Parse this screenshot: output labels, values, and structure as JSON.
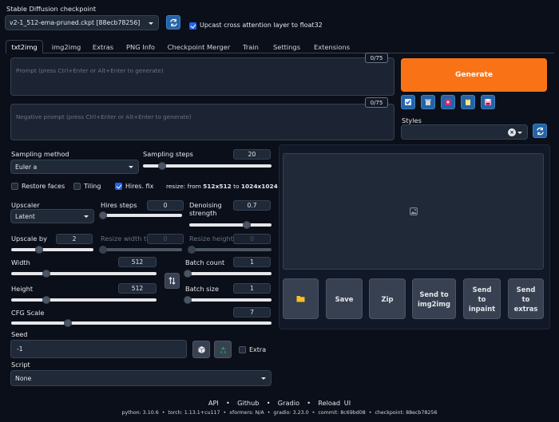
{
  "header": {
    "checkpoint_label": "Stable Diffusion checkpoint",
    "checkpoint_value": "v2-1_512-ema-pruned.ckpt [88ecb78256]",
    "upcast_label": "Upcast cross attention layer to float32"
  },
  "tabs": [
    {
      "label": "txt2img"
    },
    {
      "label": "img2img"
    },
    {
      "label": "Extras"
    },
    {
      "label": "PNG Info"
    },
    {
      "label": "Checkpoint Merger"
    },
    {
      "label": "Train"
    },
    {
      "label": "Settings"
    },
    {
      "label": "Extensions"
    }
  ],
  "prompt": {
    "placeholder": "Prompt (press Ctrl+Enter or Alt+Enter to generate)",
    "counter": "0/75"
  },
  "negative_prompt": {
    "placeholder": "Negative prompt (press Ctrl+Enter or Alt+Enter to generate)",
    "counter": "0/75"
  },
  "generate_label": "Generate",
  "styles_label": "Styles",
  "sampling": {
    "method_label": "Sampling method",
    "method_value": "Euler a",
    "steps_label": "Sampling steps",
    "steps_value": "20",
    "steps_level": 0.2
  },
  "options": {
    "restore_faces": "Restore faces",
    "tiling": "Tiling",
    "hires_fix": "Hires. fix",
    "resize_prefix": "resize: from ",
    "resize_from": "512x512",
    "resize_mid": " to ",
    "resize_to": "1024x1024"
  },
  "hires": {
    "upscaler_label": "Upscaler",
    "upscaler_value": "Latent",
    "hires_steps_label": "Hires steps",
    "hires_steps_value": "0",
    "denoising_label": "Denoising strength",
    "denoising_value": "0.7",
    "upscale_by_label": "Upscale by",
    "upscale_by_value": "2",
    "resize_width_label": "Resize width to",
    "resize_width_value": "0",
    "resize_height_label": "Resize height to",
    "resize_height_value": "0"
  },
  "size": {
    "width_label": "Width",
    "width_value": "512",
    "height_label": "Height",
    "height_value": "512",
    "batch_count_label": "Batch count",
    "batch_count_value": "1",
    "batch_size_label": "Batch size",
    "batch_size_value": "1"
  },
  "cfg": {
    "label": "CFG Scale",
    "value": "7"
  },
  "seed": {
    "label": "Seed",
    "value": "-1",
    "extra_label": "Extra"
  },
  "script": {
    "label": "Script",
    "value": "None"
  },
  "gallery_buttons": [
    "Save",
    "Zip",
    "Send to img2img",
    "Send to inpaint",
    "Send to extras"
  ],
  "footer": {
    "links": [
      "API",
      "Github",
      "Gradio",
      "Reload UI"
    ],
    "sep": "•",
    "info": "python: 3.10.6  •  torch: 1.13.1+cu117  •  xformers: N/A  •  gradio: 3.23.0  •  commit: 8c69bd08  •  checkpoint: 88ecb78256"
  },
  "colors": {
    "accent": "#f97316",
    "primary": "#2563eb",
    "background": "#0b0f19",
    "panel": "#1f2937"
  }
}
